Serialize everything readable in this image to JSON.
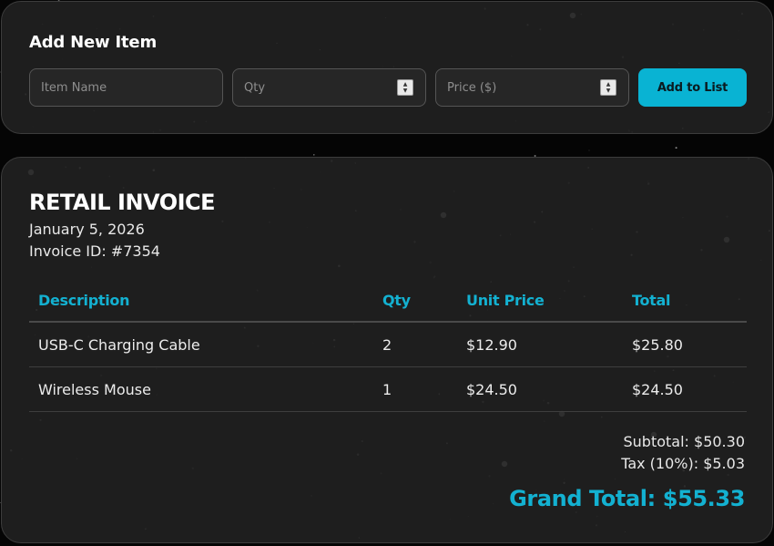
{
  "add_item": {
    "title": "Add New Item",
    "item_name_placeholder": "Item Name",
    "qty_placeholder": "Qty",
    "price_placeholder": "Price ($)",
    "add_button_label": "Add to List"
  },
  "invoice": {
    "title": "RETAIL INVOICE",
    "date": "January 5, 2026",
    "invoice_id": "Invoice ID: #7354",
    "columns": {
      "description": "Description",
      "qty": "Qty",
      "unit_price": "Unit Price",
      "total": "Total"
    },
    "rows": [
      {
        "description": "USB-C Charging Cable",
        "qty": "2",
        "unit_price": "$12.90",
        "total": "$25.80"
      },
      {
        "description": "Wireless Mouse",
        "qty": "1",
        "unit_price": "$24.50",
        "total": "$24.50"
      }
    ],
    "subtotal": "Subtotal: $50.30",
    "tax": "Tax (10%): $5.03",
    "grand_total": "Grand Total: $55.33"
  },
  "theme": {
    "accent": "#13b1d1",
    "button": "#09b3d3",
    "panel": "#202020",
    "background": "#050505"
  }
}
